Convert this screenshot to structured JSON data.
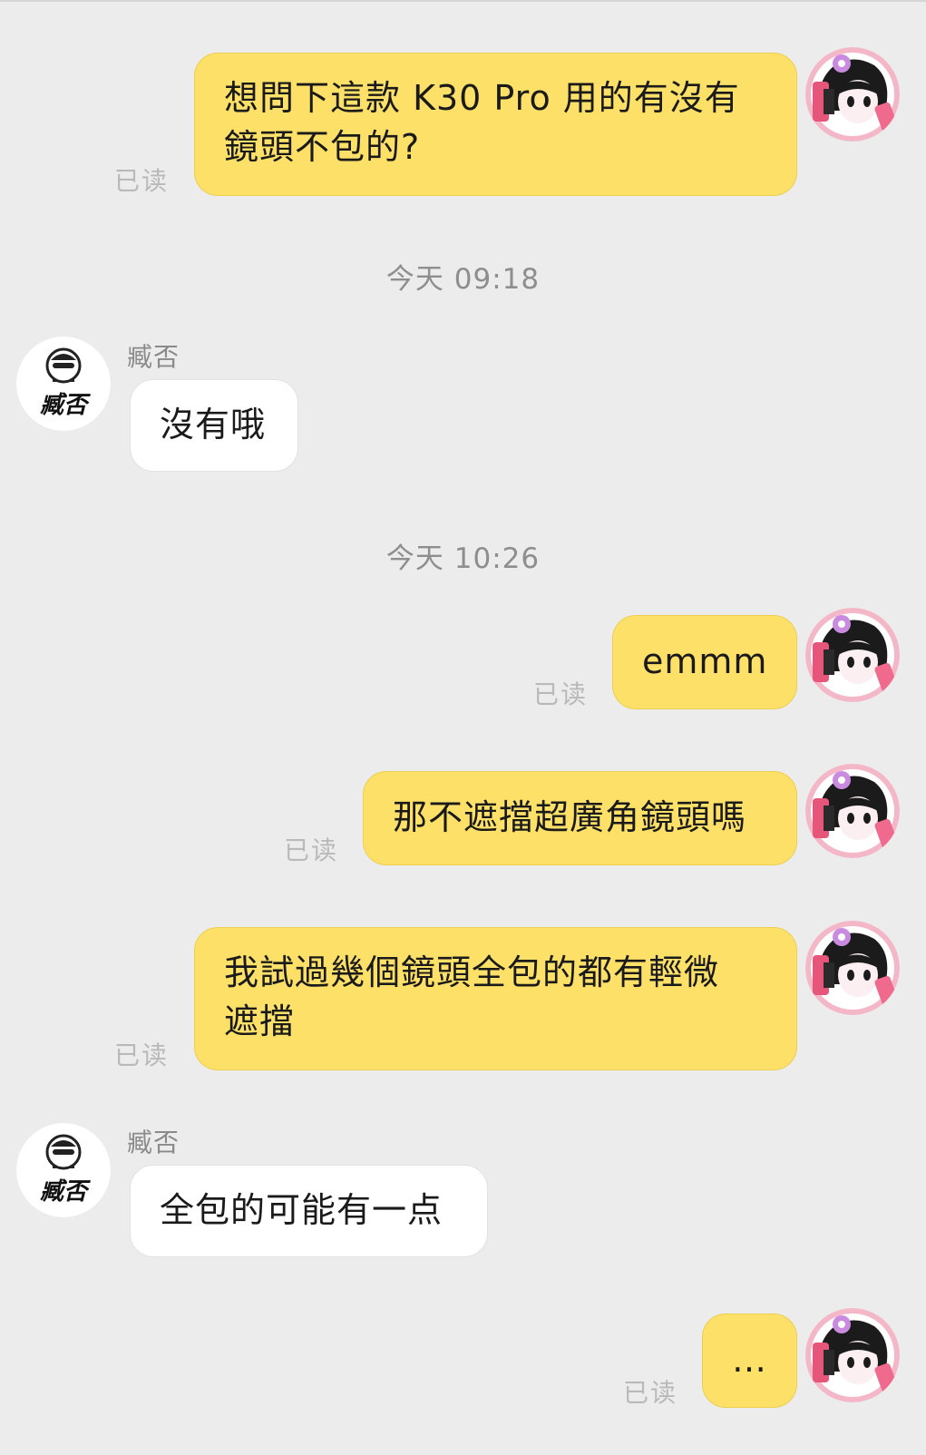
{
  "conversation": {
    "contact_name": "臧否",
    "contact_avatar_text": "臧否",
    "read_label": "已读",
    "timestamps": [
      "今天 09:18",
      "今天 10:26"
    ],
    "messages": [
      {
        "from": "me",
        "text": "想問下這款 K30 Pro 用的有沒有\n鏡頭不包的?",
        "status": "已读"
      },
      {
        "from": "them",
        "sender": "臧否",
        "text": "沒有哦"
      },
      {
        "from": "me",
        "text": "emmm",
        "status": "已读"
      },
      {
        "from": "me",
        "text": "那不遮擋超廣角鏡頭嗎",
        "status": "已读"
      },
      {
        "from": "me",
        "text": "我試過幾個鏡頭全包的都有輕微\n遮擋",
        "status": "已读"
      },
      {
        "from": "them",
        "sender": "臧否",
        "text": "全包的可能有一点"
      },
      {
        "from": "me",
        "text": "…",
        "status": "已读"
      }
    ]
  },
  "colors": {
    "background": "#ececec",
    "my_bubble": "#fde068",
    "their_bubble": "#ffffff",
    "read_text": "#b9b9b9",
    "timestamp_text": "#8e8e8e"
  },
  "icons": {
    "my_avatar": "anime-girl-avatar-icon",
    "contact_avatar": "man-with-sunglasses-avatar-icon"
  }
}
